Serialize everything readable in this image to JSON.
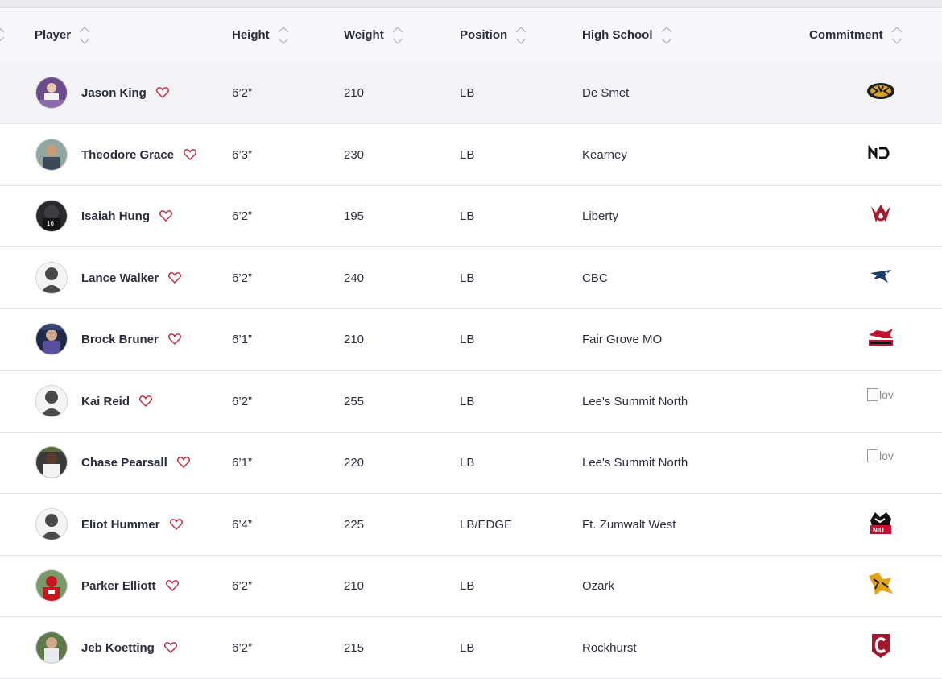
{
  "columns": {
    "player": "Player",
    "height": "Height",
    "weight": "Weight",
    "position": "Position",
    "high_school": "High School",
    "commitment": "Commitment"
  },
  "rows": [
    {
      "name": "Jason King",
      "height": "6’2”",
      "weight": "210",
      "position": "LB",
      "school": "De Smet",
      "logo": "tiger-logo",
      "broken_text": ""
    },
    {
      "name": "Theodore Grace",
      "height": "6’3”",
      "weight": "230",
      "position": "LB",
      "school": "Kearney",
      "logo": "nd-logo",
      "broken_text": ""
    },
    {
      "name": "Isaiah Hung",
      "height": "6’2”",
      "weight": "195",
      "position": "LB",
      "school": "Liberty",
      "logo": "wsu-logo",
      "broken_text": ""
    },
    {
      "name": "Lance Walker",
      "height": "6’2”",
      "weight": "240",
      "position": "LB",
      "school": "CBC",
      "logo": "bird-logo",
      "broken_text": ""
    },
    {
      "name": "Brock Bruner",
      "height": "6’1”",
      "weight": "210",
      "position": "LB",
      "school": "Fair Grove MO",
      "logo": "redhawk-logo",
      "broken_text": ""
    },
    {
      "name": "Kai Reid",
      "height": "6’2”",
      "weight": "255",
      "position": "LB",
      "school": "Lee's Summit North",
      "logo": "broken-image",
      "broken_text": "lov"
    },
    {
      "name": "Chase Pearsall",
      "height": "6’1”",
      "weight": "220",
      "position": "LB",
      "school": "Lee's Summit North",
      "logo": "broken-image",
      "broken_text": "lov"
    },
    {
      "name": "Eliot Hummer",
      "height": "6’4”",
      "weight": "225",
      "position": "LB/EDGE",
      "school": "Ft. Zumwalt West",
      "logo": "husky-logo",
      "broken_text": ""
    },
    {
      "name": "Parker Elliott",
      "height": "6’2”",
      "weight": "210",
      "position": "LB",
      "school": "Ozark",
      "logo": "hornet-logo",
      "broken_text": ""
    },
    {
      "name": "Jeb Koetting",
      "height": "6’2”",
      "weight": "215",
      "position": "LB",
      "school": "Rockhurst",
      "logo": "c-logo",
      "broken_text": ""
    }
  ],
  "colors": {
    "heart": "#c0253a",
    "row_highlight": "#f3f3f5",
    "header_bg": "#f7f7f9"
  }
}
